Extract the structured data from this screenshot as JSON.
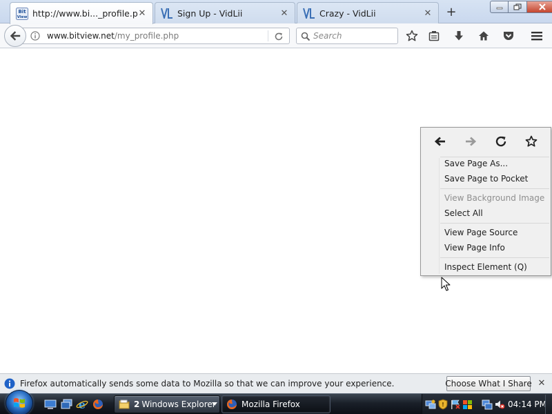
{
  "browser": {
    "tabs": [
      {
        "title": "http://www.bi..._profile.php",
        "favicon": "bitview-icon",
        "active": true
      },
      {
        "title": "Sign Up - VidLii",
        "favicon": "vidlii-icon",
        "active": false
      },
      {
        "title": "Crazy - VidLii",
        "favicon": "vidlii-icon",
        "active": false
      }
    ],
    "new_tab_label": "+",
    "close_glyph": "✕"
  },
  "navbar": {
    "url_host": "www.bitview.net",
    "url_path": "/my_profile.php",
    "search_placeholder": "Search",
    "icons": [
      "back-arrow-icon",
      "info-icon",
      "reload-icon",
      "search-icon",
      "bookmark-star-icon",
      "reading-list-icon",
      "download-icon",
      "home-icon",
      "pocket-icon",
      "hamburger-menu-icon"
    ]
  },
  "context_menu": {
    "nav_icons": [
      "back-arrow-icon",
      "forward-arrow-icon",
      "reload-icon",
      "bookmark-star-icon"
    ],
    "items": [
      {
        "label": "Save Page As...",
        "disabled": false
      },
      {
        "label": "Save Page to Pocket",
        "disabled": false
      },
      {
        "label": "View Background Image",
        "disabled": true
      },
      {
        "label": "Select All",
        "disabled": false
      },
      {
        "label": "View Page Source",
        "disabled": false
      },
      {
        "label": "View Page Info",
        "disabled": false
      },
      {
        "label": "Inspect Element (Q)",
        "disabled": false
      }
    ]
  },
  "notification": {
    "text": "Firefox automatically sends some data to Mozilla so that we can improve your experience.",
    "button_label": "Choose What I Share"
  },
  "taskbar": {
    "explorer_count": "2",
    "explorer_label": "Windows Explorer",
    "firefox_label": "Mozilla Firefox",
    "clock": "04:14 PM"
  },
  "colors": {
    "tab_strip": "#d0ddef",
    "menu_background": "#f0f0f0",
    "taskbar": "#1a2029",
    "accent_blue": "#2a6fc3"
  }
}
